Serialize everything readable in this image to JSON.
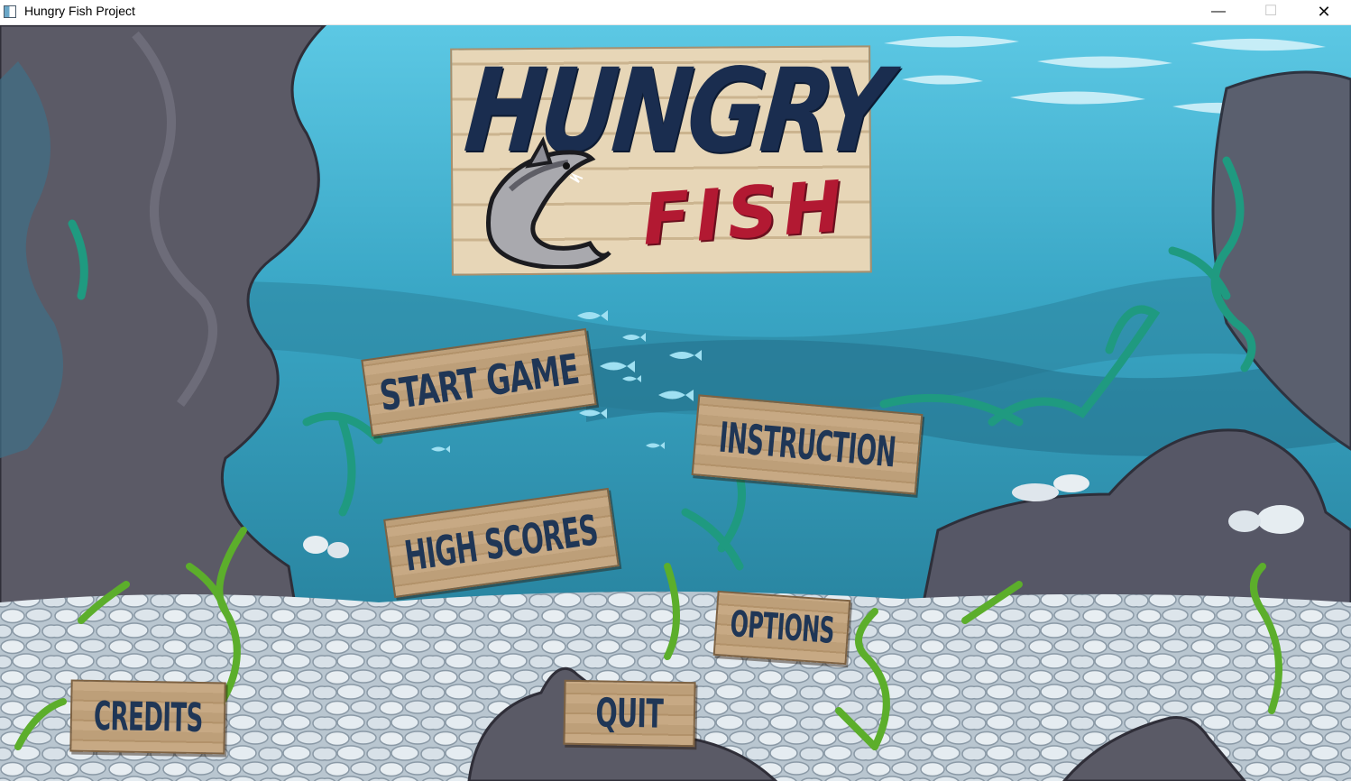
{
  "window": {
    "title": "Hungry Fish Project",
    "minimize_glyph": "—",
    "maximize_glyph": "☐",
    "close_glyph": "✕",
    "icon": "app-window-icon"
  },
  "logo": {
    "title": "HUNGRY",
    "subtitle": "FISH",
    "mascot_icon": "shark-icon",
    "colors": {
      "title": "#1a2d4f",
      "subtitle": "#b21932"
    }
  },
  "menu": {
    "start_game": "START GAME",
    "instruction": "INSTRUCTION",
    "high_scores": "HIGH SCORES",
    "options": "OPTIONS",
    "credits": "CREDITS",
    "quit": "QUIT"
  },
  "colors": {
    "water": "#2e8fac",
    "water_light": "#6fd3ec",
    "rock": "#5a5a66",
    "pebbles": "#dfe6ec",
    "seaweed": "#1f9a80",
    "wood": "#c7a984",
    "button_text": "#1f3656"
  }
}
